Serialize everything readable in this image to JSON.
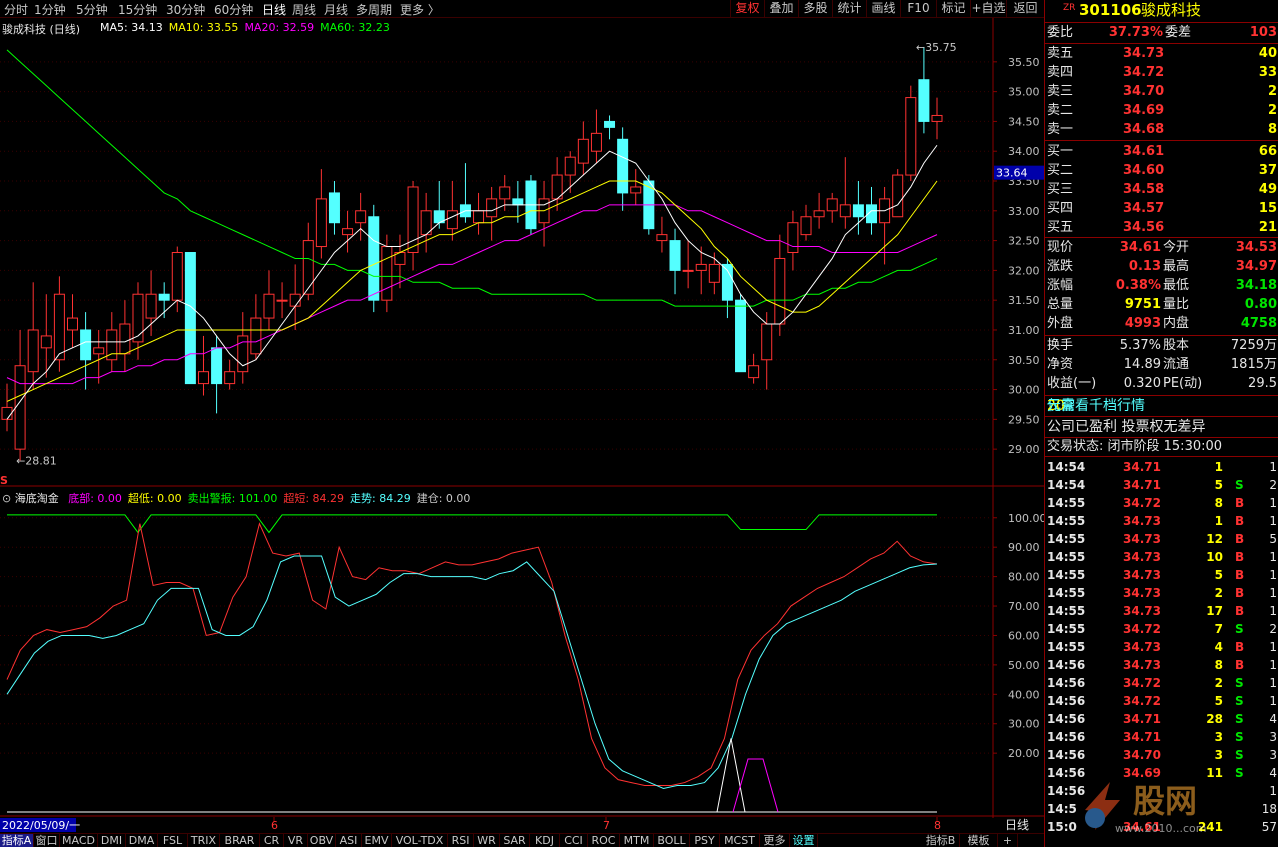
{
  "toolbar": {
    "periods": [
      "分时",
      "1分钟",
      "5分钟",
      "15分钟",
      "30分钟",
      "60分钟",
      "日线",
      "周线",
      "月线",
      "多周期",
      "更多 〉"
    ],
    "active_period": "日线",
    "right_buttons": [
      "复权",
      "叠加",
      "多股",
      "统计",
      "画线",
      "F10",
      "标记",
      "+自选",
      "返回"
    ]
  },
  "main_chart": {
    "stock_title": "骏成科技 (日线)",
    "ma_legend": [
      {
        "label": "MA5: 34.13",
        "color": "#ffffff"
      },
      {
        "label": "MA10: 33.55",
        "color": "#ffff00"
      },
      {
        "label": "MA20: 32.59",
        "color": "#ff00ff"
      },
      {
        "label": "MA60: 32.23",
        "color": "#00ff00"
      }
    ],
    "price_ticks": [
      "35.50",
      "35.00",
      "34.50",
      "34.00",
      "33.50",
      "33.00",
      "32.50",
      "32.00",
      "31.50",
      "31.00",
      "30.50",
      "30.00",
      "29.50",
      "29.00"
    ],
    "current_price_marker": "33.64",
    "high_annotation": "35.75",
    "low_annotation": "28.81",
    "s_marker": "S",
    "candles": [
      {
        "o": 29.5,
        "c": 29.7,
        "h": 30.1,
        "l": 29.3
      },
      {
        "o": 29.0,
        "c": 30.4,
        "h": 31.0,
        "l": 28.81
      },
      {
        "o": 30.3,
        "c": 31.0,
        "h": 31.8,
        "l": 30.0
      },
      {
        "o": 30.7,
        "c": 30.9,
        "h": 31.6,
        "l": 30.2
      },
      {
        "o": 30.5,
        "c": 31.6,
        "h": 31.9,
        "l": 30.3
      },
      {
        "o": 31.0,
        "c": 31.2,
        "h": 31.6,
        "l": 30.7
      },
      {
        "o": 31.0,
        "c": 30.5,
        "h": 31.3,
        "l": 30.0
      },
      {
        "o": 30.6,
        "c": 30.7,
        "h": 31.0,
        "l": 30.1
      },
      {
        "o": 30.5,
        "c": 31.0,
        "h": 31.3,
        "l": 30.3
      },
      {
        "o": 30.6,
        "c": 31.1,
        "h": 31.5,
        "l": 30.3
      },
      {
        "o": 30.8,
        "c": 31.6,
        "h": 31.8,
        "l": 30.5
      },
      {
        "o": 31.2,
        "c": 31.6,
        "h": 32.0,
        "l": 30.9
      },
      {
        "o": 31.6,
        "c": 31.5,
        "h": 31.8,
        "l": 31.2
      },
      {
        "o": 31.5,
        "c": 32.3,
        "h": 32.4,
        "l": 31.3
      },
      {
        "o": 32.3,
        "c": 30.1,
        "h": 32.3,
        "l": 30.1
      },
      {
        "o": 30.1,
        "c": 30.3,
        "h": 30.9,
        "l": 29.9
      },
      {
        "o": 30.7,
        "c": 30.1,
        "h": 30.9,
        "l": 29.6
      },
      {
        "o": 30.1,
        "c": 30.3,
        "h": 30.5,
        "l": 30.0
      },
      {
        "o": 30.3,
        "c": 30.9,
        "h": 31.3,
        "l": 30.1
      },
      {
        "o": 30.6,
        "c": 31.2,
        "h": 31.6,
        "l": 30.5
      },
      {
        "o": 31.2,
        "c": 31.6,
        "h": 32.0,
        "l": 31.0
      },
      {
        "o": 31.5,
        "c": 31.5,
        "h": 31.8,
        "l": 31.2
      },
      {
        "o": 31.4,
        "c": 31.6,
        "h": 32.1,
        "l": 31.0
      },
      {
        "o": 31.6,
        "c": 32.5,
        "h": 32.8,
        "l": 31.5
      },
      {
        "o": 32.4,
        "c": 33.2,
        "h": 33.7,
        "l": 32.2
      },
      {
        "o": 33.3,
        "c": 32.8,
        "h": 33.5,
        "l": 32.6
      },
      {
        "o": 32.6,
        "c": 32.7,
        "h": 33.0,
        "l": 32.3
      },
      {
        "o": 32.8,
        "c": 33.0,
        "h": 33.3,
        "l": 32.5
      },
      {
        "o": 32.9,
        "c": 31.5,
        "h": 33.1,
        "l": 31.3
      },
      {
        "o": 31.5,
        "c": 32.4,
        "h": 32.6,
        "l": 31.3
      },
      {
        "o": 32.1,
        "c": 32.3,
        "h": 32.6,
        "l": 31.7
      },
      {
        "o": 32.3,
        "c": 33.4,
        "h": 33.5,
        "l": 32.0
      },
      {
        "o": 32.6,
        "c": 33.0,
        "h": 33.3,
        "l": 32.3
      },
      {
        "o": 33.0,
        "c": 32.8,
        "h": 33.5,
        "l": 32.7
      },
      {
        "o": 32.7,
        "c": 33.0,
        "h": 33.5,
        "l": 32.5
      },
      {
        "o": 33.1,
        "c": 32.9,
        "h": 33.8,
        "l": 32.8
      },
      {
        "o": 32.8,
        "c": 33.0,
        "h": 33.3,
        "l": 32.6
      },
      {
        "o": 32.9,
        "c": 33.2,
        "h": 33.4,
        "l": 32.5
      },
      {
        "o": 33.2,
        "c": 33.4,
        "h": 33.6,
        "l": 33.0
      },
      {
        "o": 33.2,
        "c": 33.1,
        "h": 33.5,
        "l": 32.8
      },
      {
        "o": 33.5,
        "c": 32.7,
        "h": 33.6,
        "l": 32.6
      },
      {
        "o": 32.8,
        "c": 33.2,
        "h": 33.5,
        "l": 32.4
      },
      {
        "o": 33.2,
        "c": 33.6,
        "h": 33.9,
        "l": 33.0
      },
      {
        "o": 33.6,
        "c": 33.9,
        "h": 34.0,
        "l": 33.3
      },
      {
        "o": 33.8,
        "c": 34.2,
        "h": 34.5,
        "l": 33.6
      },
      {
        "o": 34.0,
        "c": 34.3,
        "h": 34.7,
        "l": 33.8
      },
      {
        "o": 34.5,
        "c": 34.4,
        "h": 34.6,
        "l": 34.2
      },
      {
        "o": 34.2,
        "c": 33.3,
        "h": 34.4,
        "l": 33.0
      },
      {
        "o": 33.3,
        "c": 33.4,
        "h": 33.7,
        "l": 33.1
      },
      {
        "o": 33.5,
        "c": 32.7,
        "h": 33.6,
        "l": 32.6
      },
      {
        "o": 32.5,
        "c": 32.6,
        "h": 32.9,
        "l": 32.3
      },
      {
        "o": 32.5,
        "c": 32.0,
        "h": 32.7,
        "l": 31.6
      },
      {
        "o": 32.0,
        "c": 32.0,
        "h": 32.5,
        "l": 31.7
      },
      {
        "o": 32.0,
        "c": 32.1,
        "h": 32.4,
        "l": 31.6
      },
      {
        "o": 31.8,
        "c": 32.1,
        "h": 32.3,
        "l": 31.6
      },
      {
        "o": 32.1,
        "c": 31.5,
        "h": 32.2,
        "l": 31.2
      },
      {
        "o": 31.5,
        "c": 30.3,
        "h": 31.6,
        "l": 30.3
      },
      {
        "o": 30.2,
        "c": 30.4,
        "h": 30.6,
        "l": 30.1
      },
      {
        "o": 30.5,
        "c": 31.1,
        "h": 31.3,
        "l": 30.0
      },
      {
        "o": 31.1,
        "c": 32.2,
        "h": 32.6,
        "l": 30.9
      },
      {
        "o": 32.3,
        "c": 32.8,
        "h": 33.0,
        "l": 32.0
      },
      {
        "o": 32.6,
        "c": 32.9,
        "h": 33.1,
        "l": 32.5
      },
      {
        "o": 32.9,
        "c": 33.0,
        "h": 33.3,
        "l": 32.7
      },
      {
        "o": 33.0,
        "c": 33.2,
        "h": 33.3,
        "l": 32.8
      },
      {
        "o": 32.9,
        "c": 33.1,
        "h": 33.9,
        "l": 32.7
      },
      {
        "o": 33.1,
        "c": 32.9,
        "h": 33.5,
        "l": 32.6
      },
      {
        "o": 33.1,
        "c": 32.8,
        "h": 33.4,
        "l": 32.6
      },
      {
        "o": 32.8,
        "c": 33.2,
        "h": 33.4,
        "l": 32.1
      },
      {
        "o": 32.9,
        "c": 33.6,
        "h": 33.7,
        "l": 32.9
      },
      {
        "o": 33.6,
        "c": 34.9,
        "h": 35.1,
        "l": 33.5
      },
      {
        "o": 35.2,
        "c": 34.5,
        "h": 35.75,
        "l": 34.3
      },
      {
        "o": 34.5,
        "c": 34.6,
        "h": 34.9,
        "l": 34.2
      }
    ],
    "ma5": [
      29.5,
      29.8,
      30.1,
      30.3,
      30.6,
      30.7,
      30.8,
      30.8,
      30.8,
      30.8,
      30.9,
      31.1,
      31.3,
      31.5,
      31.4,
      31.2,
      30.9,
      30.6,
      30.4,
      30.5,
      30.8,
      31.1,
      31.4,
      31.7,
      32.0,
      32.3,
      32.5,
      32.7,
      32.5,
      32.4,
      32.4,
      32.5,
      32.6,
      32.8,
      32.9,
      33.0,
      33.0,
      33.0,
      33.1,
      33.1,
      33.1,
      33.1,
      33.2,
      33.4,
      33.6,
      33.8,
      34.0,
      33.9,
      33.8,
      33.5,
      33.2,
      32.8,
      32.5,
      32.3,
      32.2,
      32.0,
      31.6,
      31.3,
      31.1,
      31.1,
      31.3,
      31.6,
      31.9,
      32.2,
      32.6,
      32.8,
      33.0,
      33.0,
      33.1,
      33.4,
      33.8,
      34.1
    ],
    "ma10": [
      29.8,
      29.9,
      30.0,
      30.1,
      30.2,
      30.3,
      30.4,
      30.5,
      30.6,
      30.6,
      30.7,
      30.8,
      30.9,
      31.0,
      31.0,
      31.0,
      31.0,
      31.0,
      31.0,
      31.0,
      31.0,
      31.0,
      31.1,
      31.2,
      31.4,
      31.6,
      31.8,
      32.0,
      32.1,
      32.2,
      32.3,
      32.4,
      32.5,
      32.6,
      32.6,
      32.7,
      32.8,
      32.8,
      32.9,
      32.9,
      33.0,
      33.0,
      33.1,
      33.2,
      33.3,
      33.4,
      33.5,
      33.5,
      33.5,
      33.4,
      33.3,
      33.1,
      32.9,
      32.7,
      32.4,
      32.2,
      31.9,
      31.7,
      31.5,
      31.4,
      31.3,
      31.3,
      31.4,
      31.6,
      31.8,
      32.0,
      32.2,
      32.4,
      32.6,
      32.9,
      33.2,
      33.5
    ],
    "ma20": [
      30.2,
      30.1,
      30.1,
      30.1,
      30.1,
      30.1,
      30.2,
      30.2,
      30.3,
      30.3,
      30.4,
      30.4,
      30.5,
      30.5,
      30.6,
      30.6,
      30.7,
      30.7,
      30.8,
      30.8,
      30.9,
      31.0,
      31.1,
      31.2,
      31.3,
      31.4,
      31.5,
      31.5,
      31.6,
      31.7,
      31.8,
      31.9,
      32.0,
      32.1,
      32.1,
      32.2,
      32.3,
      32.4,
      32.5,
      32.5,
      32.6,
      32.7,
      32.8,
      32.9,
      33.0,
      33.0,
      33.1,
      33.1,
      33.1,
      33.1,
      33.1,
      33.1,
      33.0,
      33.0,
      32.9,
      32.8,
      32.7,
      32.6,
      32.5,
      32.5,
      32.4,
      32.4,
      32.4,
      32.3,
      32.3,
      32.3,
      32.3,
      32.3,
      32.3,
      32.4,
      32.5,
      32.6
    ],
    "ma60": [
      35.7,
      35.5,
      35.3,
      35.1,
      34.9,
      34.7,
      34.5,
      34.3,
      34.1,
      33.9,
      33.7,
      33.5,
      33.3,
      33.2,
      33.0,
      32.9,
      32.8,
      32.7,
      32.6,
      32.5,
      32.4,
      32.3,
      32.2,
      32.2,
      32.1,
      32.1,
      32.0,
      32.0,
      31.9,
      31.9,
      31.9,
      31.8,
      31.8,
      31.8,
      31.7,
      31.7,
      31.7,
      31.6,
      31.6,
      31.6,
      31.6,
      31.6,
      31.6,
      31.6,
      31.6,
      31.5,
      31.5,
      31.5,
      31.5,
      31.5,
      31.5,
      31.4,
      31.4,
      31.4,
      31.4,
      31.4,
      31.4,
      31.4,
      31.5,
      31.5,
      31.5,
      31.6,
      31.6,
      31.7,
      31.7,
      31.8,
      31.8,
      31.9,
      32.0,
      32.0,
      32.1,
      32.2
    ]
  },
  "indicator": {
    "name": "海底淘金",
    "legend": [
      {
        "label": "底部: 0.00",
        "color": "#ff00ff"
      },
      {
        "label": "超低: 0.00",
        "color": "#ffff00"
      },
      {
        "label": "卖出警报: 101.00",
        "color": "#00ff00"
      },
      {
        "label": "超短: 84.29",
        "color": "#ff3232"
      },
      {
        "label": "走势: 84.29",
        "color": "#54ffff"
      },
      {
        "label": "建仓: 0.00",
        "color": "#c8c8c8"
      }
    ],
    "ticks": [
      "100.00",
      "90.00",
      "80.00",
      "70.00",
      "60.00",
      "50.00",
      "40.00",
      "30.00",
      "20.00"
    ],
    "red_line": [
      45,
      55,
      60,
      62,
      61,
      62,
      63,
      66,
      70,
      72,
      98,
      77,
      78,
      78,
      76,
      60,
      61,
      73,
      80,
      98,
      88,
      87,
      88,
      72,
      69,
      90,
      80,
      79,
      83,
      82,
      82,
      81,
      83,
      85,
      84,
      84,
      85,
      86,
      88,
      89,
      90,
      78,
      60,
      45,
      25,
      15,
      11,
      10,
      9,
      9,
      9,
      10,
      12,
      15,
      25,
      45,
      55,
      60,
      64,
      70,
      73,
      76,
      78,
      80,
      83,
      86,
      88,
      92,
      87,
      85,
      84.29
    ],
    "cyan_line": [
      40,
      47,
      54,
      58,
      60,
      60,
      60,
      59,
      60,
      62,
      64,
      72,
      76,
      76,
      76,
      62,
      60,
      60,
      63,
      72,
      85,
      87,
      87,
      87,
      73,
      70,
      72,
      74,
      78,
      81,
      81,
      80,
      80,
      80,
      80,
      79,
      81,
      82,
      85,
      80,
      75,
      60,
      45,
      30,
      18,
      14,
      12,
      10,
      8,
      9,
      9,
      10,
      15,
      25,
      40,
      52,
      60,
      64,
      66,
      68,
      70,
      72,
      75,
      77,
      79,
      81,
      83,
      84,
      84.29
    ],
    "green_line": [
      101,
      101,
      101,
      101,
      101,
      101,
      101,
      101,
      101,
      101,
      95,
      101,
      101,
      101,
      101,
      101,
      101,
      101,
      101,
      101,
      95,
      101,
      101,
      101,
      101,
      101,
      101,
      101,
      101,
      101,
      101,
      101,
      101,
      101,
      101,
      101,
      101,
      101,
      101,
      101,
      101,
      101,
      101,
      101,
      101,
      101,
      101,
      101,
      101,
      101,
      101,
      101,
      101,
      101,
      101,
      101,
      96,
      96,
      96,
      96,
      96,
      96,
      101,
      101,
      101,
      101,
      101,
      101,
      101,
      101,
      101,
      101
    ]
  },
  "bottom_axis": {
    "date_label": "2022/05/09/一",
    "month_marks": [
      "6",
      "7",
      "8"
    ],
    "right_label": "日线"
  },
  "bottom_tabs": [
    "指标A",
    "窗口",
    "MACD",
    "DMI",
    "DMA",
    "FSL",
    "TRIX",
    "BRAR",
    "CR",
    "VR",
    "OBV",
    "ASI",
    "EMV",
    "VOL-TDX",
    "RSI",
    "WR",
    "SAR",
    "KDJ",
    "CCI",
    "ROC",
    "MTM",
    "BOLL",
    "PSY",
    "MCST",
    "更多",
    "设置"
  ],
  "bottom_right_tabs": [
    "指标B",
    "模板",
    "+"
  ],
  "quote": {
    "code_prefix": "ZR",
    "code": "301106",
    "name": "骏成科技",
    "wei_bi_label": "委比",
    "wei_bi_value": "37.73%",
    "wei_cha_label": "委差",
    "wei_cha_value": "103",
    "sells": [
      {
        "label": "卖五",
        "price": "34.73",
        "vol": "40"
      },
      {
        "label": "卖四",
        "price": "34.72",
        "vol": "33"
      },
      {
        "label": "卖三",
        "price": "34.70",
        "vol": "2"
      },
      {
        "label": "卖二",
        "price": "34.69",
        "vol": "2"
      },
      {
        "label": "卖一",
        "price": "34.68",
        "vol": "8"
      }
    ],
    "buys": [
      {
        "label": "买一",
        "price": "34.61",
        "vol": "66"
      },
      {
        "label": "买二",
        "price": "34.60",
        "vol": "37"
      },
      {
        "label": "买三",
        "price": "34.58",
        "vol": "49"
      },
      {
        "label": "买四",
        "price": "34.57",
        "vol": "15"
      },
      {
        "label": "买五",
        "price": "34.56",
        "vol": "21"
      }
    ],
    "stats": [
      {
        "l1": "现价",
        "v1": "34.61",
        "c1": "red",
        "l2": "今开",
        "v2": "34.53",
        "c2": "red"
      },
      {
        "l1": "涨跌",
        "v1": "0.13",
        "c1": "red",
        "l2": "最高",
        "v2": "34.97",
        "c2": "red"
      },
      {
        "l1": "涨幅",
        "v1": "0.38%",
        "c1": "red",
        "l2": "最低",
        "v2": "34.18",
        "c2": "green"
      },
      {
        "l1": "总量",
        "v1": "9751",
        "c1": "yellow",
        "l2": "量比",
        "v2": "0.80",
        "c2": "green"
      },
      {
        "l1": "外盘",
        "v1": "4993",
        "c1": "red",
        "l2": "内盘",
        "v2": "4758",
        "c2": "green"
      }
    ],
    "stats2": [
      {
        "l1": "换手",
        "v1": "5.37%",
        "l2": "股本",
        "v2": "7259万"
      },
      {
        "l1": "净资",
        "v1": "14.89",
        "l2": "流通",
        "v2": "1815万"
      },
      {
        "l1": "收益(一)",
        "v1": "0.320",
        "l2": "PE(动)",
        "v2": "29.5"
      }
    ],
    "promo_line1_a": "仅需",
    "promo_line1_b": "20",
    "promo_line1_c": "元查看千档行情",
    "promo_line2": "公司已盈利 投票权无差异",
    "trade_status": "交易状态: 闭市阶段 15:30:00",
    "ticks": [
      {
        "t": "14:54",
        "p": "34.71",
        "v": "1",
        "s": "",
        "n": "1"
      },
      {
        "t": "14:54",
        "p": "34.71",
        "v": "5",
        "s": "S",
        "n": "2"
      },
      {
        "t": "14:55",
        "p": "34.72",
        "v": "8",
        "s": "B",
        "n": "1"
      },
      {
        "t": "14:55",
        "p": "34.73",
        "v": "1",
        "s": "B",
        "n": "1"
      },
      {
        "t": "14:55",
        "p": "34.73",
        "v": "12",
        "s": "B",
        "n": "5"
      },
      {
        "t": "14:55",
        "p": "34.73",
        "v": "10",
        "s": "B",
        "n": "1"
      },
      {
        "t": "14:55",
        "p": "34.73",
        "v": "5",
        "s": "B",
        "n": "1"
      },
      {
        "t": "14:55",
        "p": "34.73",
        "v": "2",
        "s": "B",
        "n": "1"
      },
      {
        "t": "14:55",
        "p": "34.73",
        "v": "17",
        "s": "B",
        "n": "1"
      },
      {
        "t": "14:55",
        "p": "34.72",
        "v": "7",
        "s": "S",
        "n": "2"
      },
      {
        "t": "14:55",
        "p": "34.73",
        "v": "4",
        "s": "B",
        "n": "1"
      },
      {
        "t": "14:56",
        "p": "34.73",
        "v": "8",
        "s": "B",
        "n": "1"
      },
      {
        "t": "14:56",
        "p": "34.72",
        "v": "2",
        "s": "S",
        "n": "1"
      },
      {
        "t": "14:56",
        "p": "34.72",
        "v": "5",
        "s": "S",
        "n": "1"
      },
      {
        "t": "14:56",
        "p": "34.71",
        "v": "28",
        "s": "S",
        "n": "4"
      },
      {
        "t": "14:56",
        "p": "34.71",
        "v": "3",
        "s": "S",
        "n": "3"
      },
      {
        "t": "14:56",
        "p": "34.70",
        "v": "3",
        "s": "S",
        "n": "3"
      },
      {
        "t": "14:56",
        "p": "34.69",
        "v": "11",
        "s": "S",
        "n": "4"
      },
      {
        "t": "14:56",
        "p": "",
        "v": "",
        "s": "",
        "n": "1"
      },
      {
        "t": "14:5",
        "p": "",
        "v": "",
        "s": "",
        "n": "18"
      },
      {
        "t": "15:0",
        "p": "34.61",
        "v": "241",
        "s": "",
        "n": "57"
      }
    ]
  },
  "colors": {
    "up": "#ff3232",
    "down": "#54ffff",
    "grid": "#8b0000",
    "ma5": "#ffffff",
    "ma10": "#ffff00",
    "ma20": "#ff00ff",
    "ma60": "#00ff00"
  }
}
